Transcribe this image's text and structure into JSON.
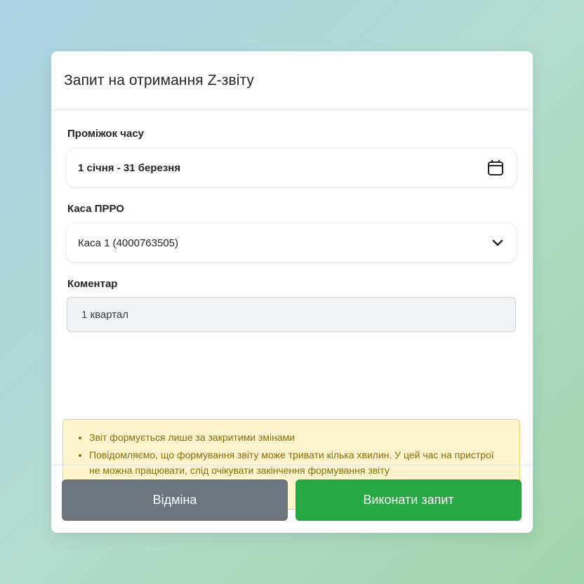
{
  "modal": {
    "title": "Запит на отримання Z-звіту"
  },
  "fields": {
    "period": {
      "label": "Проміжок часу",
      "value": "1 січня - 31 березня",
      "icon": "calendar-icon"
    },
    "register": {
      "label": "Каса ПРРО",
      "value": "Каса 1 (4000763505)",
      "icon": "chevron-down-icon"
    },
    "comment": {
      "label": "Коментар",
      "value": "1 квартал"
    }
  },
  "alert": {
    "items": [
      "Звіт формується лише за закритими змінами",
      "Повідомляємо, що формування звіту може тривати кілька хвилин. У цей час на пристрої не можна працювати, слід очікувати закінчення формування звіту"
    ]
  },
  "footer": {
    "cancel_label": "Відміна",
    "submit_label": "Виконати запит"
  },
  "colors": {
    "cancel": "#6c757d",
    "submit": "#28a745",
    "alert_bg": "#fdf3cd",
    "alert_text": "#8a6d0d"
  }
}
